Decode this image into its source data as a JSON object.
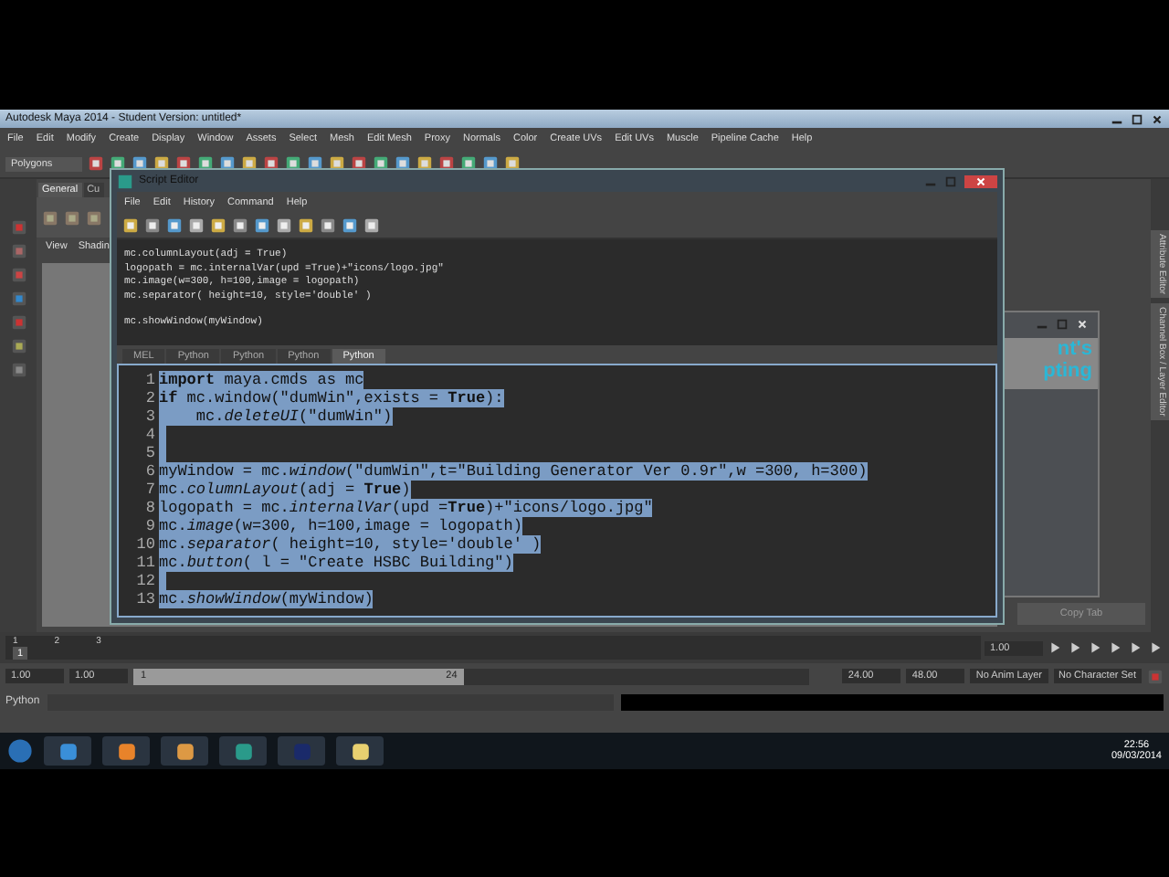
{
  "window": {
    "title": "Autodesk Maya 2014 - Student Version: untitled*"
  },
  "menu": [
    "File",
    "Edit",
    "Modify",
    "Create",
    "Display",
    "Window",
    "Assets",
    "Select",
    "Mesh",
    "Edit Mesh",
    "Proxy",
    "Normals",
    "Color",
    "Create UVs",
    "Edit UVs",
    "Muscle",
    "Pipeline Cache",
    "Help"
  ],
  "menu_set": "Polygons",
  "shelf_tabs": [
    {
      "label": "General",
      "selected": true
    },
    {
      "label": "Cu",
      "selected": false
    }
  ],
  "panel_menu": [
    "View",
    "Shadin"
  ],
  "side_tabs": [
    "Attribute Editor",
    "Channel Box / Layer Editor"
  ],
  "copy_tab_button": "Copy Tab",
  "logo_window": {
    "lines": [
      "nt's",
      "pting"
    ]
  },
  "script_editor": {
    "title": "Script Editor",
    "menu": [
      "File",
      "Edit",
      "History",
      "Command",
      "Help"
    ],
    "output": [
      {
        "text": "mc.columnLayout(adj = True)"
      },
      {
        "text": "logopath = mc.internalVar(upd =True)+\"icons/logo.jpg\""
      },
      {
        "text": "mc.image(w=300, h=100,image = logopath)"
      },
      {
        "text": "mc.separator( height=10, style='double' )"
      },
      {
        "text": "mc.showWindow(myWindow)"
      }
    ],
    "tabs": [
      {
        "label": "MEL",
        "selected": false
      },
      {
        "label": "Python",
        "selected": false
      },
      {
        "label": "Python",
        "selected": false
      },
      {
        "label": "Python",
        "selected": false
      },
      {
        "label": "Python",
        "selected": true
      }
    ],
    "code": [
      {
        "number": "1",
        "text": "**import** maya.cmds as mc",
        "selected": true
      },
      {
        "number": "2",
        "text": "**if** mc.window(\"dumWin\",exists = **True**):",
        "selected": true
      },
      {
        "number": "3",
        "text": "    mc.*deleteUI*(\"dumWin\")",
        "selected": true
      },
      {
        "number": "4",
        "selected": true
      },
      {
        "number": "5",
        "selected": true
      },
      {
        "number": "6",
        "text": "myWindow = mc.*window*(\"dumWin\",t=\"Building Generator Ver 0.9r\",w =300, h=300)",
        "selected": true
      },
      {
        "number": "7",
        "text": "mc.*columnLayout*(adj = **True**)",
        "selected": true
      },
      {
        "number": "8",
        "text": "logopath = mc.*internalVar*(upd =**True**)+\"icons/logo.jpg\"",
        "selected": true
      },
      {
        "number": "9",
        "text": "mc.*image*(w=300, h=100,image = logopath)",
        "selected": true
      },
      {
        "number": "10",
        "text": "mc.*separator*( height=10, style='double' )",
        "selected": true
      },
      {
        "number": "11",
        "text": "mc.*button*( l = \"Create HSBC Building\")",
        "selected": true
      },
      {
        "number": "12",
        "selected": true
      },
      {
        "number": "13",
        "text": "mc.*showWindow*(myWindow)",
        "selected": true
      }
    ]
  },
  "timeline": {
    "ticks": [
      "1",
      "2",
      "3"
    ],
    "current": "1",
    "level": 0,
    "end_field": "1.00"
  },
  "range": {
    "start": "1.00",
    "playback_start": "1.00",
    "slider_start": "1",
    "slider_end": "24",
    "level": 0.49,
    "playback_end": "24.00",
    "end": "48.00",
    "anim_layer": "No Anim Layer",
    "character_set": "No Character Set"
  },
  "command_line": {
    "label": "Python"
  },
  "taskbar": {
    "time": "22:56",
    "date": "09/03/2014"
  }
}
